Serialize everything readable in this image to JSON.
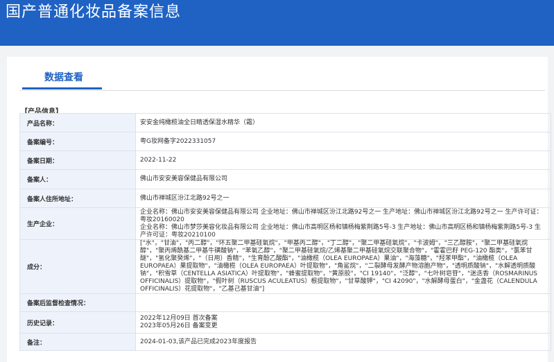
{
  "header": {
    "title": "国产普通化妆品备案信息"
  },
  "tab": {
    "label": "数据查看"
  },
  "section": {
    "label": "【产品信息】"
  },
  "rows": [
    {
      "label": "产品名称：",
      "value": "安安金纯橄榄油全日睛透保湿水精华（霜）"
    },
    {
      "label": "备案编号：",
      "value": "粤G妆网备字2022331057"
    },
    {
      "label": "备案日期：",
      "value": "2022-11-22"
    },
    {
      "label": "备案人：",
      "value": "佛山市安安美容保健品有限公司"
    },
    {
      "label": "备案人住所地址：",
      "value": "佛山市禅城区汾江北路92号之一"
    },
    {
      "label": "生产企业：",
      "value": "企业名称：佛山市安安美容保健品有限公司 企业地址：佛山市禅城区汾江北路92号之一 生产地址：佛山市禅城区汾江北路92号之一 生产许可证：粤妆20160020\n企业名称：佛山市梦莎美容化妆品有限公司 企业地址：佛山市高明区杨和镇杨梅紫荆路5号-3 生产地址：佛山市高明区杨和镇杨梅紫荆路5号-3 生产许可证：粤妆20210100"
    },
    {
      "label": "成分：",
      "value": "[\"水\"，\"甘油\"，\"丙二醇\"，\"环五聚二甲基硅氧烷\"，\"甲基丙二醇\"，\"丁二醇\"，\"聚二甲基硅氧烷\"，\"卡波姆\"，\"三乙醇胺\"，\"聚二甲基硅氧烷醇\"，\"聚丙烯酰基二甲基牛磺酸钠\"，\"苯氧乙醇\"，\"聚二甲基硅氧烷/乙烯基聚二甲基硅氧烷交联聚合物\"，\"霍霍巴籽 PEG-120 酯类\"，\"氯苯甘醚\"，\"氢化聚癸烯\"，\"（日用）香精\"，\"生育酚乙酸酯\"，\"油橄榄（OLEA EUROPAEA）果油\"，\"海藻糖\"，\"羟苯甲酯\"，\"油橄榄（OLEA EUROPAEA）果提取物\"，\"油橄榄（OLEA EUROPAEA）叶提取物\"，\"角鲨烷\"，\"二裂酵母发酵产物溶胞产物\"，\"透明质酸钠\"，\"水解透明质酸钠\"，\"积雪草（CENTELLA ASIATICA）叶提取物\"，\"蜂蜜提取物\"，\"黄原胶\"，\"CI 19140\"，\"泛醇\"，\"七叶树皂苷\"，\"迷迭香（ROSMARINUS OFFICINALIS）提取物\"，\"假叶树（RUSCUS ACULEATUS）根提取物\"，\"甘草酸钾\"，\"CI 42090\"，\"水解酵母蛋白\"，\"金盏花（CALENDULA OFFICINALIS）花提取物\"，\"乙基己基甘油\"]"
    },
    {
      "label": "备案后监督检查情况：",
      "value": ""
    },
    {
      "label": "历史记录：",
      "value": "2022年12月09日 首次备案\n2023年05月26日 备案变更"
    },
    {
      "label": "备注：",
      "value": "2024-01-03,该产品已完成2023年度报告"
    }
  ]
}
